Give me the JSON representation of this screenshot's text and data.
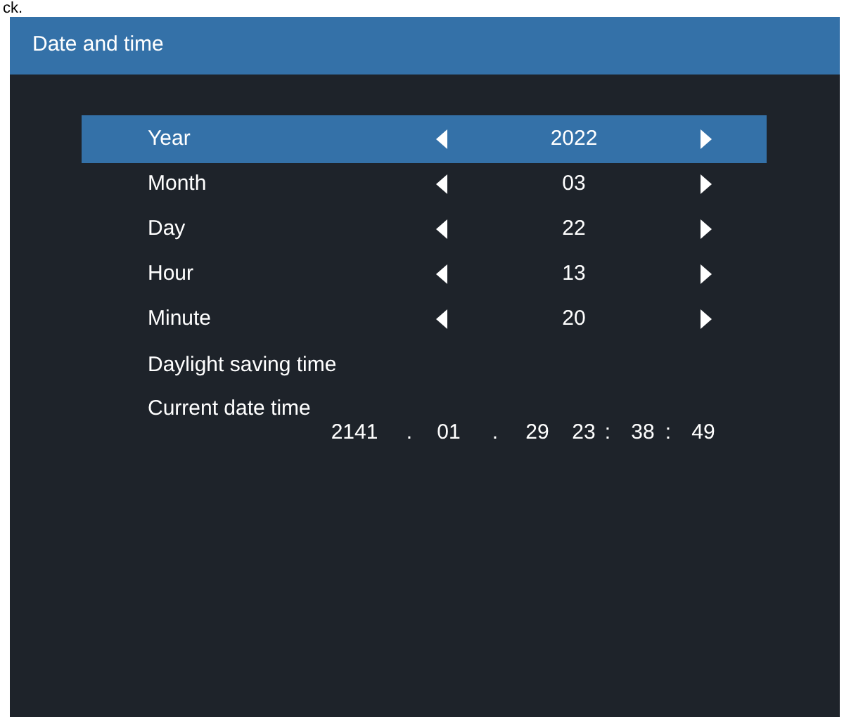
{
  "page_fragment": "ck.",
  "window": {
    "title": "Date and time"
  },
  "settings": [
    {
      "kind": "stepper",
      "label": "Year",
      "value": "2022",
      "selected": true
    },
    {
      "kind": "stepper",
      "label": "Month",
      "value": "03",
      "selected": false
    },
    {
      "kind": "stepper",
      "label": "Day",
      "value": "22",
      "selected": false
    },
    {
      "kind": "stepper",
      "label": "Hour",
      "value": "13",
      "selected": false
    },
    {
      "kind": "stepper",
      "label": "Minute",
      "value": "20",
      "selected": false
    },
    {
      "kind": "item",
      "label": "Daylight saving time",
      "selected": false
    },
    {
      "kind": "readout",
      "label": "Current date time",
      "selected": false,
      "parts": [
        "2141",
        ".",
        "01",
        ".",
        "29",
        "23",
        ":",
        "38",
        ":",
        "49"
      ]
    }
  ]
}
